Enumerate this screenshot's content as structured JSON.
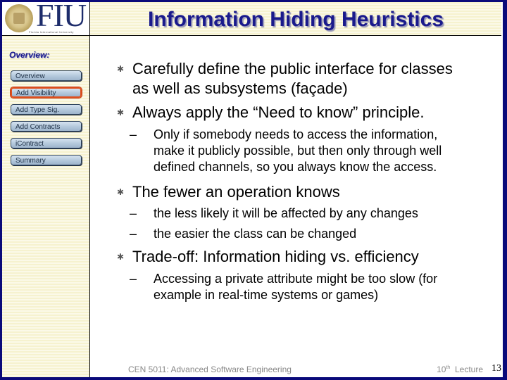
{
  "header": {
    "logo_text": "FIU",
    "logo_subtitle": "Florida International University",
    "title": "Information Hiding Heuristics"
  },
  "sidebar": {
    "heading": "Overview:",
    "items": [
      {
        "label": "Overview",
        "active": false
      },
      {
        "label": "Add Visibility",
        "active": true
      },
      {
        "label": "Add Type Sig.",
        "active": false
      },
      {
        "label": "Add Contracts",
        "active": false
      },
      {
        "label": "iContract",
        "active": false
      },
      {
        "label": "Summary",
        "active": false
      }
    ],
    "active_color": "#e0501e"
  },
  "content": {
    "bullets": [
      {
        "text_line1": "Carefully define the public interface for classes",
        "text_line2": "as well as subsystems (façade)"
      },
      {
        "text": "Always apply the “Need to know” principle.",
        "sub": [
          {
            "line1": "Only if somebody needs to access the information,",
            "line2": "make it publicly possible, but then only through well",
            "line3": "defined channels, so you always know the access."
          }
        ]
      },
      {
        "text": "The fewer an operation knows",
        "sub": [
          {
            "line1": "the less likely it will be affected by any changes"
          },
          {
            "line1": "the easier the class can be changed"
          }
        ]
      },
      {
        "text": "Trade-off: Information hiding vs. efficiency",
        "sub": [
          {
            "line1": "Accessing a private attribute might be too slow (for",
            "line2": "example in real-time systems or games)"
          }
        ]
      }
    ],
    "bullet_glyph": "✱",
    "dash_glyph": "–"
  },
  "footer": {
    "course": "CEN 5011: Advanced Software Engineering",
    "lecture_num": "10",
    "lecture_sup": "th",
    "lecture_word": "Lecture",
    "page": "13"
  },
  "colors": {
    "border": "#0a0a7a",
    "title": "#1a1a8c"
  }
}
